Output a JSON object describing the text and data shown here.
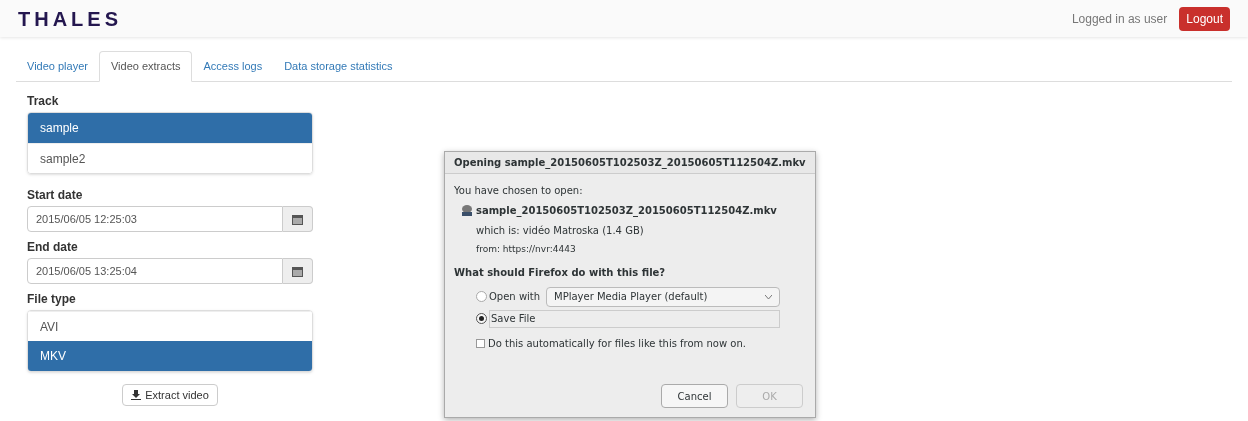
{
  "header": {
    "logo": "THALES",
    "user_text": "Logged in as user",
    "logout": "Logout"
  },
  "tabs": [
    {
      "label": "Video player",
      "selected": false
    },
    {
      "label": "Video extracts",
      "selected": true
    },
    {
      "label": "Access logs",
      "selected": false
    },
    {
      "label": "Data storage statistics",
      "selected": false
    }
  ],
  "track": {
    "label": "Track",
    "items": [
      {
        "label": "sample",
        "selected": true
      },
      {
        "label": "sample2",
        "selected": false
      }
    ]
  },
  "start_date": {
    "label": "Start date",
    "value": "2015/06/05 12:25:03"
  },
  "end_date": {
    "label": "End date",
    "value": "2015/06/05 13:25:04"
  },
  "file_type": {
    "label": "File type",
    "items": [
      {
        "label": "AVI",
        "selected": false
      },
      {
        "label": "MKV",
        "selected": true
      }
    ]
  },
  "extract_button": "Extract video",
  "dialog": {
    "title": "Opening sample_20150605T102503Z_20150605T112504Z.mkv",
    "intro": "You have chosen to open:",
    "file_name": "sample_20150605T102503Z_20150605T112504Z.mkv",
    "type_line": "which is: vidéo Matroska (1.4 GB)",
    "from_line": "from: https://nvr:4443",
    "question": "What should Firefox do with this file?",
    "options": [
      {
        "kind": "open",
        "label": "Open with",
        "selected": false,
        "app": "MPlayer Media Player (default)"
      },
      {
        "kind": "save",
        "label": "Save File",
        "selected": true
      }
    ],
    "auto": {
      "label": "Do this automatically for files like this from now on.",
      "checked": false
    },
    "buttons": [
      {
        "label": "Cancel",
        "disabled": false
      },
      {
        "label": "OK",
        "disabled": true
      }
    ]
  }
}
